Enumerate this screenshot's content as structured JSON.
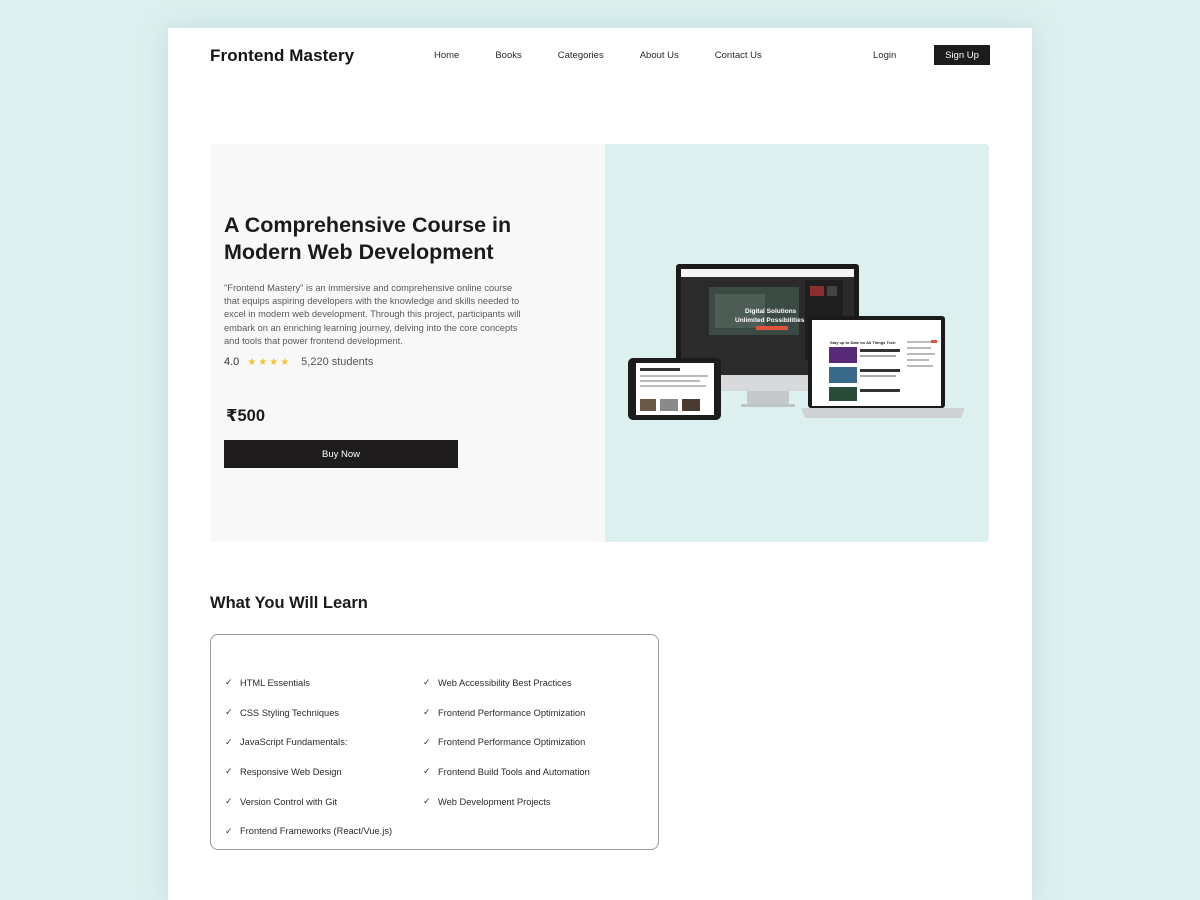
{
  "header": {
    "logo": "Frontend Mastery",
    "nav": [
      "Home",
      "Books",
      "Categories",
      "About Us",
      "Contact Us"
    ],
    "login": "Login",
    "signup": "Sign Up"
  },
  "hero": {
    "title": "A Comprehensive Course in Modern Web Development",
    "description": "\"Frontend Mastery\" is an immersive and comprehensive online course that equips aspiring developers with the knowledge and skills needed to excel in modern web development. Through this project, participants will embark on an enriching learning journey, delving into the core concepts and tools that power frontend development.",
    "rating": "4.0",
    "stars": "★★★★",
    "students": "5,220 students",
    "price": "₹500",
    "buy_label": "Buy Now",
    "monitor_text_1": "Digital Solutions",
    "monitor_text_2": "Unlimited Possibilities",
    "laptop_text": "Stay up to Date on All Things Tech"
  },
  "learn": {
    "title": "What You Will Learn",
    "col1": [
      "HTML Essentials",
      "CSS Styling Techniques",
      "JavaScript Fundamentals:",
      "Responsive Web Design",
      "Version Control with Git",
      "Frontend Frameworks (React/Vue.js)"
    ],
    "col2": [
      "Web Accessibility Best Practices",
      "Frontend Performance Optimization",
      "Frontend Performance Optimization",
      "Frontend Build Tools and Automation",
      "Web Development Projects"
    ]
  },
  "colors": {
    "background": "#dcf0ef",
    "dark": "#1e1b1c",
    "star": "#f2c233",
    "accent_red": "#e2533f"
  }
}
